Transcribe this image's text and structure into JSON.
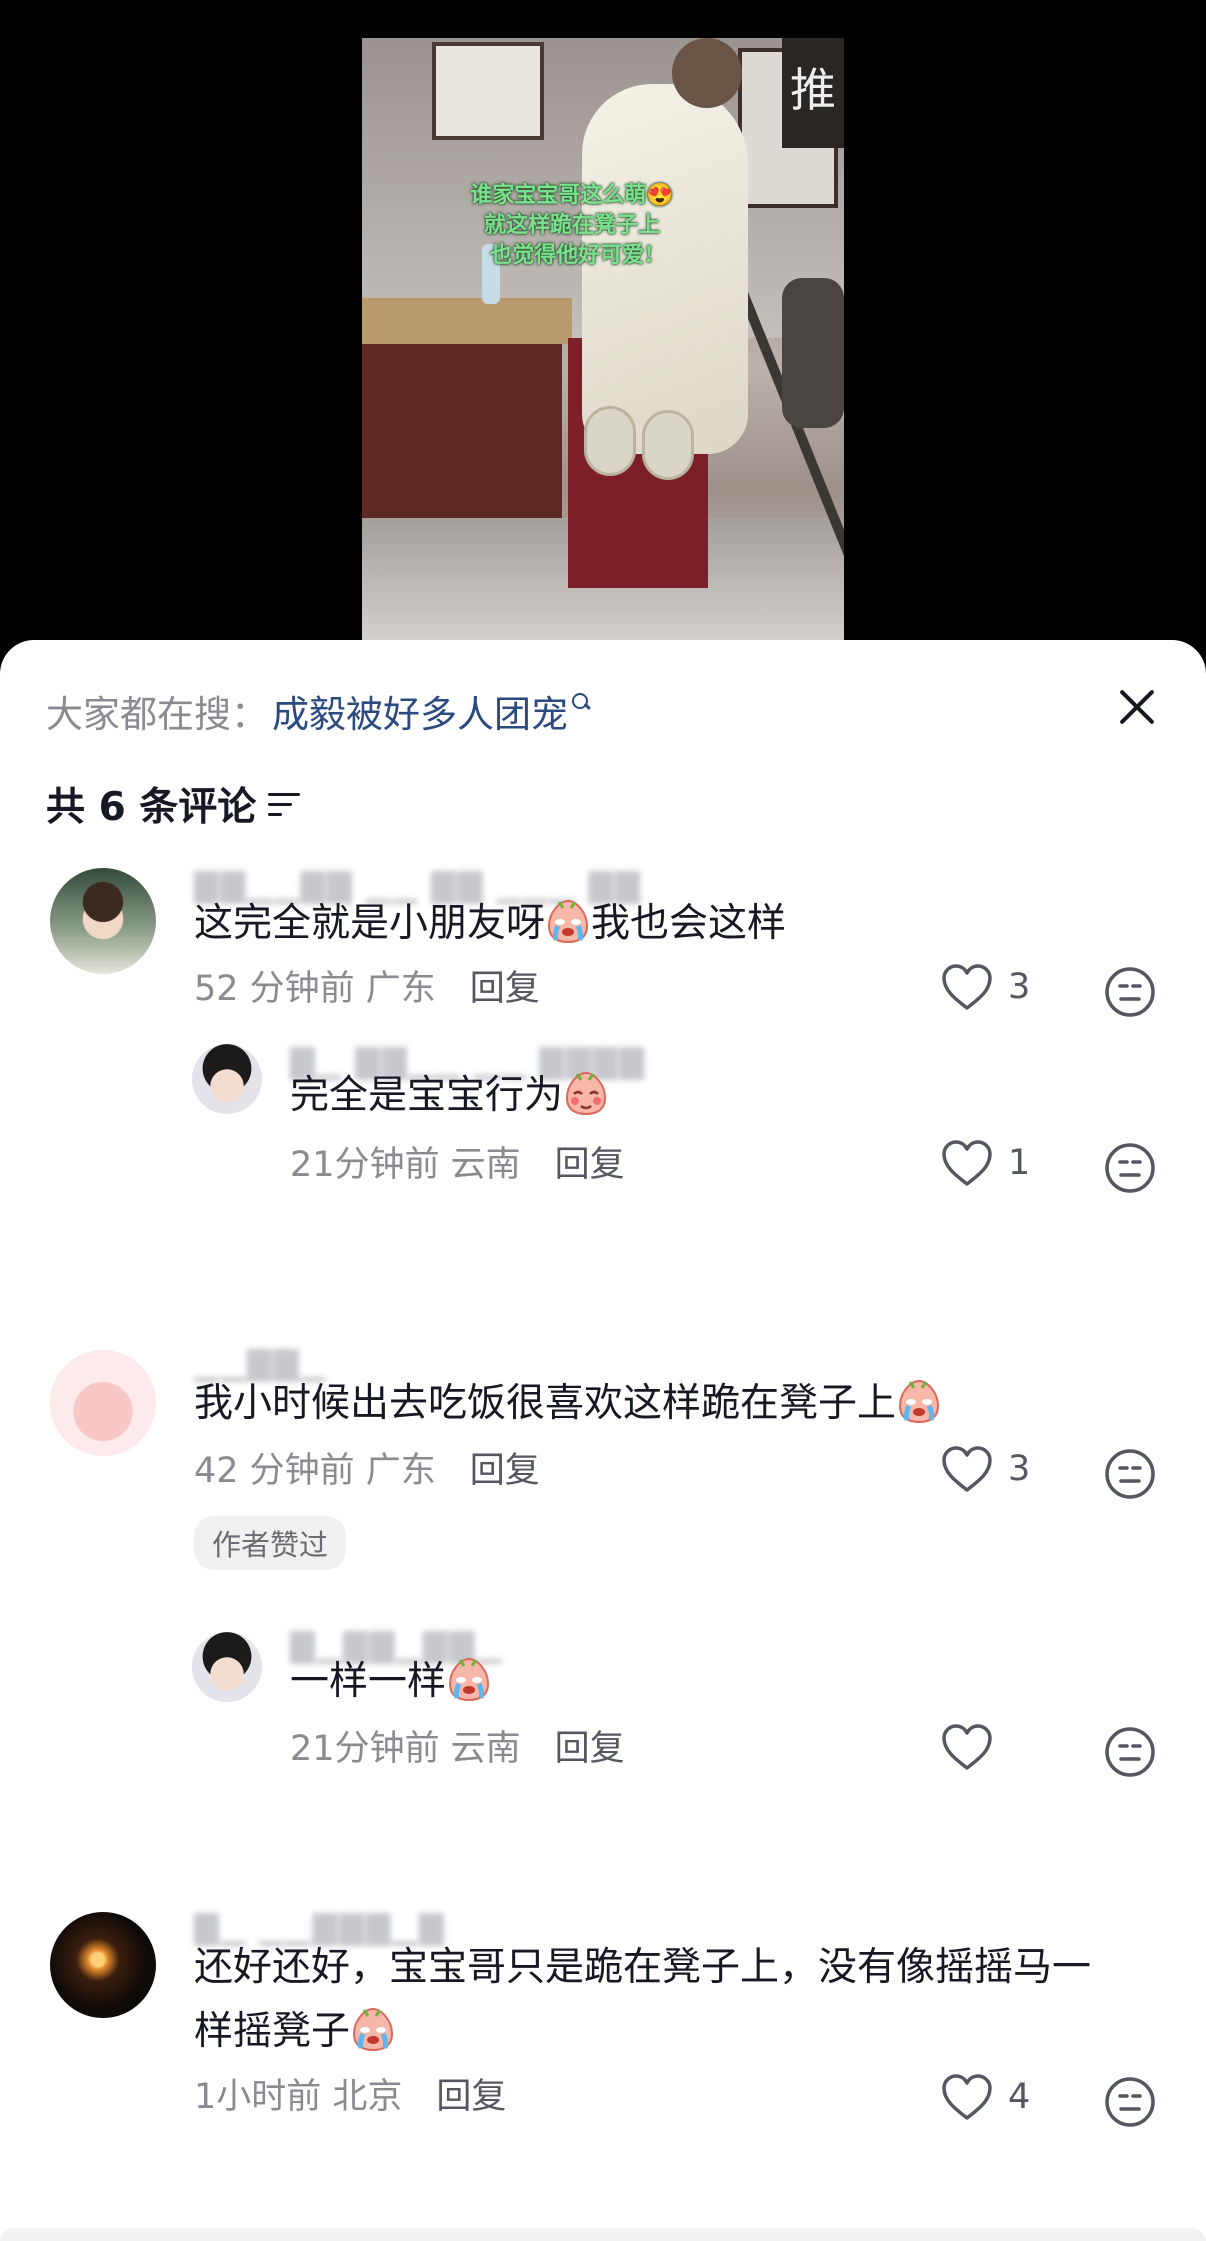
{
  "video": {
    "caption_lines": [
      "谁家宝宝哥这么萌😍",
      "就这样跪在凳子上",
      "也觉得他好可爱!"
    ],
    "sign_char": "推"
  },
  "search": {
    "prefix": "大家都在搜：",
    "keyword": "成毅被好多人团宠"
  },
  "header": {
    "comment_count": "共 6 条评论"
  },
  "comments": [
    {
      "content_before": "这完全就是小朋友呀",
      "emoji": "crying-face",
      "content_after": "我也会这样",
      "time": "52 分钟前 广东",
      "reply_label": "回复",
      "likes": "3",
      "replies": [
        {
          "content_before": "完全是宝宝行为",
          "emoji": "shy-face",
          "content_after": "",
          "time": "21分钟前 云南",
          "reply_label": "回复",
          "likes": "1"
        }
      ]
    },
    {
      "content_before": "我小时候出去吃饭很喜欢这样跪在凳子上",
      "emoji": "crying-face",
      "content_after": "",
      "time": "42 分钟前 广东",
      "reply_label": "回复",
      "likes": "3",
      "badge": "作者赞过",
      "replies": [
        {
          "content_before": "一样一样",
          "emoji": "crying-face",
          "content_after": "",
          "time": "21分钟前 云南",
          "reply_label": "回复",
          "likes": ""
        }
      ]
    },
    {
      "content_line1": "还好还好，宝宝哥只是跪在凳子上，没有像摇摇马一",
      "content_line2": "样摇凳子",
      "emoji": "crying-face",
      "time": "1小时前 北京",
      "reply_label": "回复",
      "likes": "4"
    }
  ],
  "colors": {
    "keyword": "#2b4a80",
    "meta": "#8a8b91",
    "text": "#161823"
  }
}
